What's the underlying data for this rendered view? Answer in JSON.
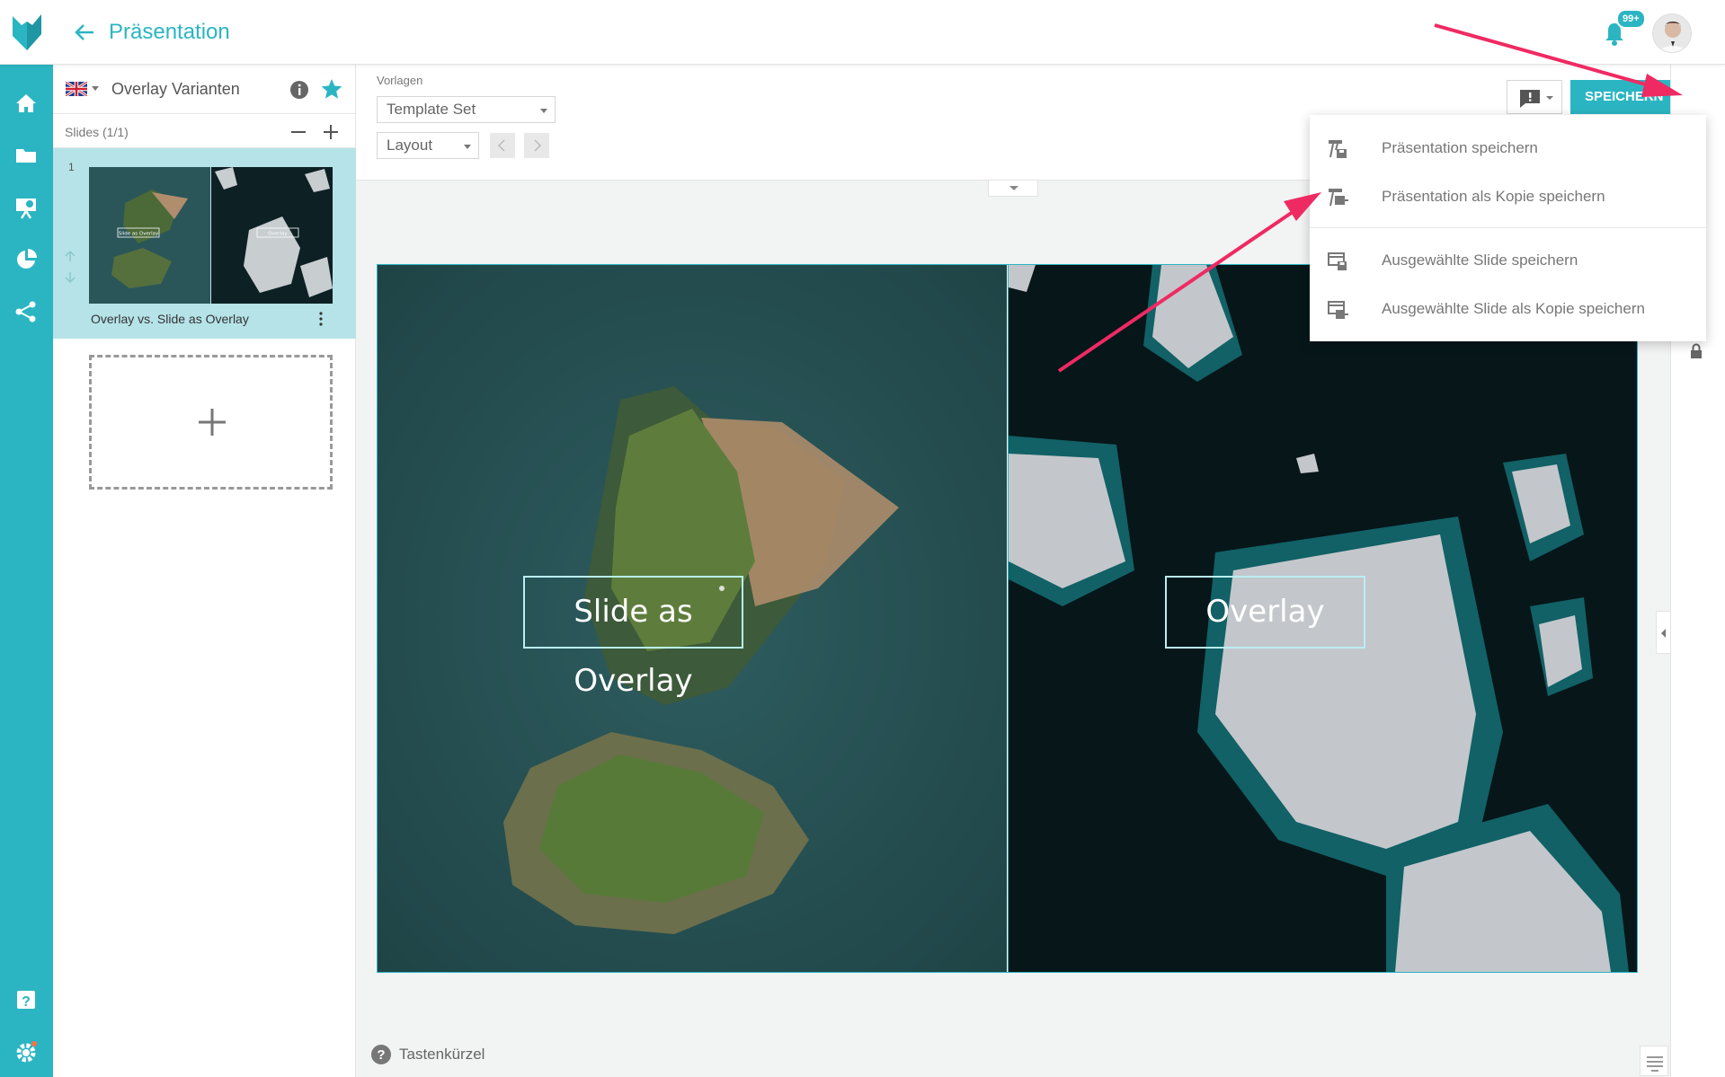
{
  "header": {
    "title": "Präsentation",
    "notification_count": "99+"
  },
  "colors": {
    "accent": "#2bb5c2",
    "slide_selected_bg": "#b5e3e8",
    "arrow": "#ef2a63"
  },
  "nav": {
    "items": [
      "home-icon",
      "folder-icon",
      "presentation-icon",
      "pie-chart-icon",
      "share-icon"
    ],
    "bottom": [
      "help-icon",
      "settings-icon"
    ]
  },
  "presentation": {
    "name": "Overlay Varianten",
    "language_flag": "uk-flag-icon"
  },
  "slides": {
    "count_label": "Slides (1/1)",
    "items": [
      {
        "number": "1",
        "label": "Overlay vs. Slide as Overlay",
        "thumb_left_text": "Slide as Overlay",
        "thumb_right_text": "Overlay"
      }
    ]
  },
  "toolbar": {
    "templates_label": "Vorlagen",
    "template_set": "Template Set",
    "layout": "Layout",
    "save_label": "SPEICHERN"
  },
  "save_menu": {
    "items": [
      {
        "label": "Präsentation speichern"
      },
      {
        "label": "Präsentation als Kopie speichern"
      },
      {
        "label": "Ausgewählte Slide speichern"
      },
      {
        "label": "Ausgewählte Slide als Kopie speichern"
      }
    ]
  },
  "canvas": {
    "left_overlay_text": "Slide as Overlay",
    "right_overlay_text": "Overlay"
  },
  "footer": {
    "shortcuts_label": "Tastenkürzel"
  }
}
